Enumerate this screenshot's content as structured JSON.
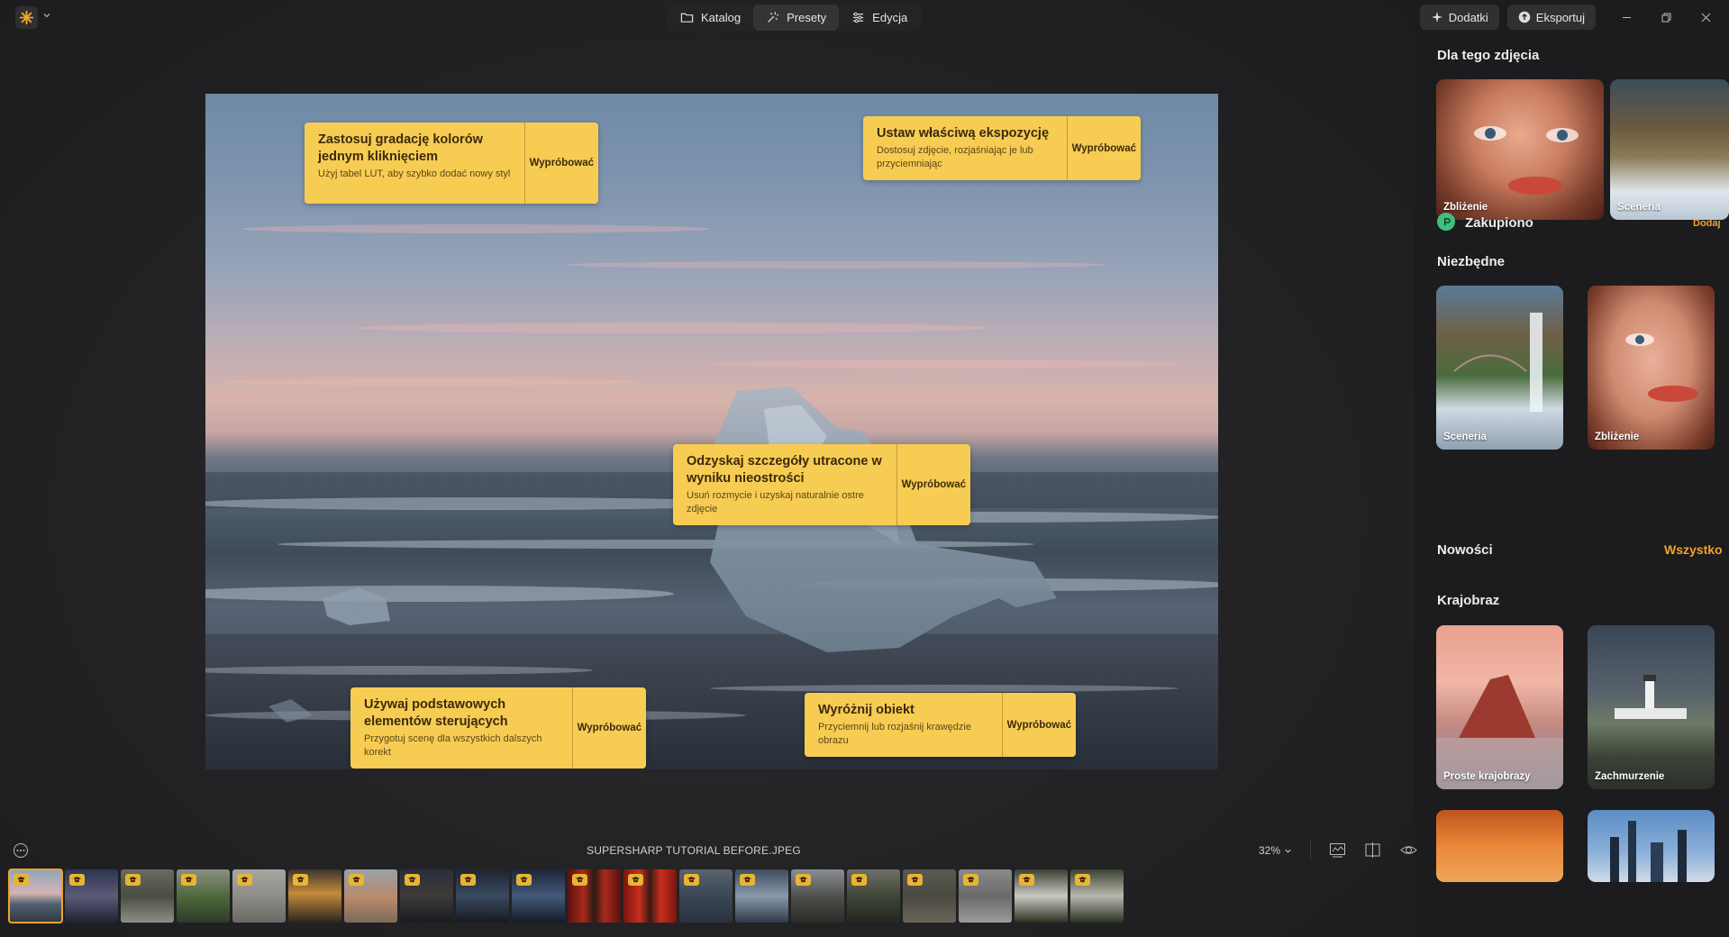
{
  "topbar": {
    "modes": [
      {
        "label": "Katalog",
        "icon": "folder-icon"
      },
      {
        "label": "Presety",
        "icon": "sparkle-icon",
        "active": true
      },
      {
        "label": "Edycja",
        "icon": "sliders-icon"
      }
    ],
    "addons_label": "Dodatki",
    "export_label": "Eksportuj"
  },
  "callouts": [
    {
      "title": "Zastosuj gradację kolorów jednym kliknięciem",
      "desc": "Użyj tabel LUT, aby szybko dodać nowy styl",
      "button": "Wypróbować"
    },
    {
      "title": "Ustaw właściwą ekspozycję",
      "desc": "Dostosuj zdjęcie, rozjaśniając je lub przyciemniając",
      "button": "Wypróbować"
    },
    {
      "title": "Odzyskaj szczegóły utracone w wyniku nieostrości",
      "desc": "Usuń rozmycie i uzyskaj naturalnie ostre zdjęcie",
      "button": "Wypróbować"
    },
    {
      "title": "Używaj podstawowych elementów sterujących",
      "desc": "Przygotuj scenę dla wszystkich dalszych korekt",
      "button": "Wypróbować"
    },
    {
      "title": "Wyróżnij obiekt",
      "desc": "Przyciemnij lub rozjaśnij krawędzie obrazu",
      "button": "Wypróbować"
    }
  ],
  "panel": {
    "for_this_photo": {
      "title": "Dla tego zdjęcia",
      "cards": [
        "Zbliżenie",
        "Sceneria"
      ]
    },
    "purchased": {
      "title": "Zakupiono",
      "action": "Dodaj"
    },
    "essentials": {
      "title": "Niezbędne",
      "cards": [
        "Sceneria",
        "Zbliżenie"
      ]
    },
    "news": {
      "title": "Nowości",
      "action": "Wszystko"
    },
    "landscape": {
      "title": "Krajobraz",
      "cards": [
        "Proste krajobrazy",
        "Zachmurzenie"
      ]
    }
  },
  "bottom": {
    "filename": "SUPERSHARP TUTORIAL BEFORE.JPEG",
    "zoom": "32%"
  },
  "colors": {
    "accent": "#f0a32a",
    "callout": "#f7cc53",
    "purchased_badge": "#3fbf7f"
  }
}
